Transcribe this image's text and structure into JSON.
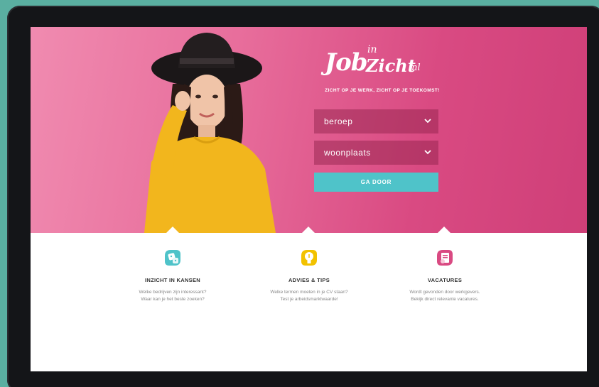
{
  "logo": {
    "job": "Job",
    "in": "in",
    "zicht": "Zicht",
    "nl": ".nl"
  },
  "tagline": "ZICHT OP JE WERK, ZICHT OP JE TOEKOMST!",
  "form": {
    "beroep": "beroep",
    "woonplaats": "woonplaats",
    "submit_label": "GA DOOR"
  },
  "features": [
    {
      "title": "INZICHT IN KANSEN",
      "line1": "Welke bedrijven zijn interessant?",
      "line2": "Waar kan je het beste zoeken?",
      "icon": "dice-icon",
      "color": "#4fc3c9"
    },
    {
      "title": "ADVIES & TIPS",
      "line1": "Welke termen moeten in je CV staan?",
      "line2": "Test je arbeidsmarktwaarde!",
      "icon": "lightbulb-icon",
      "color": "#f2c200"
    },
    {
      "title": "VACATURES",
      "line1": "Wordt gevonden door werkgevers.",
      "line2": "Bekijk direct relevante vacatures.",
      "icon": "document-icon",
      "color": "#d94a82"
    }
  ],
  "colors": {
    "accent": "#4fc3c9",
    "hero": "#e86e9c",
    "background": "#5aafa1"
  }
}
